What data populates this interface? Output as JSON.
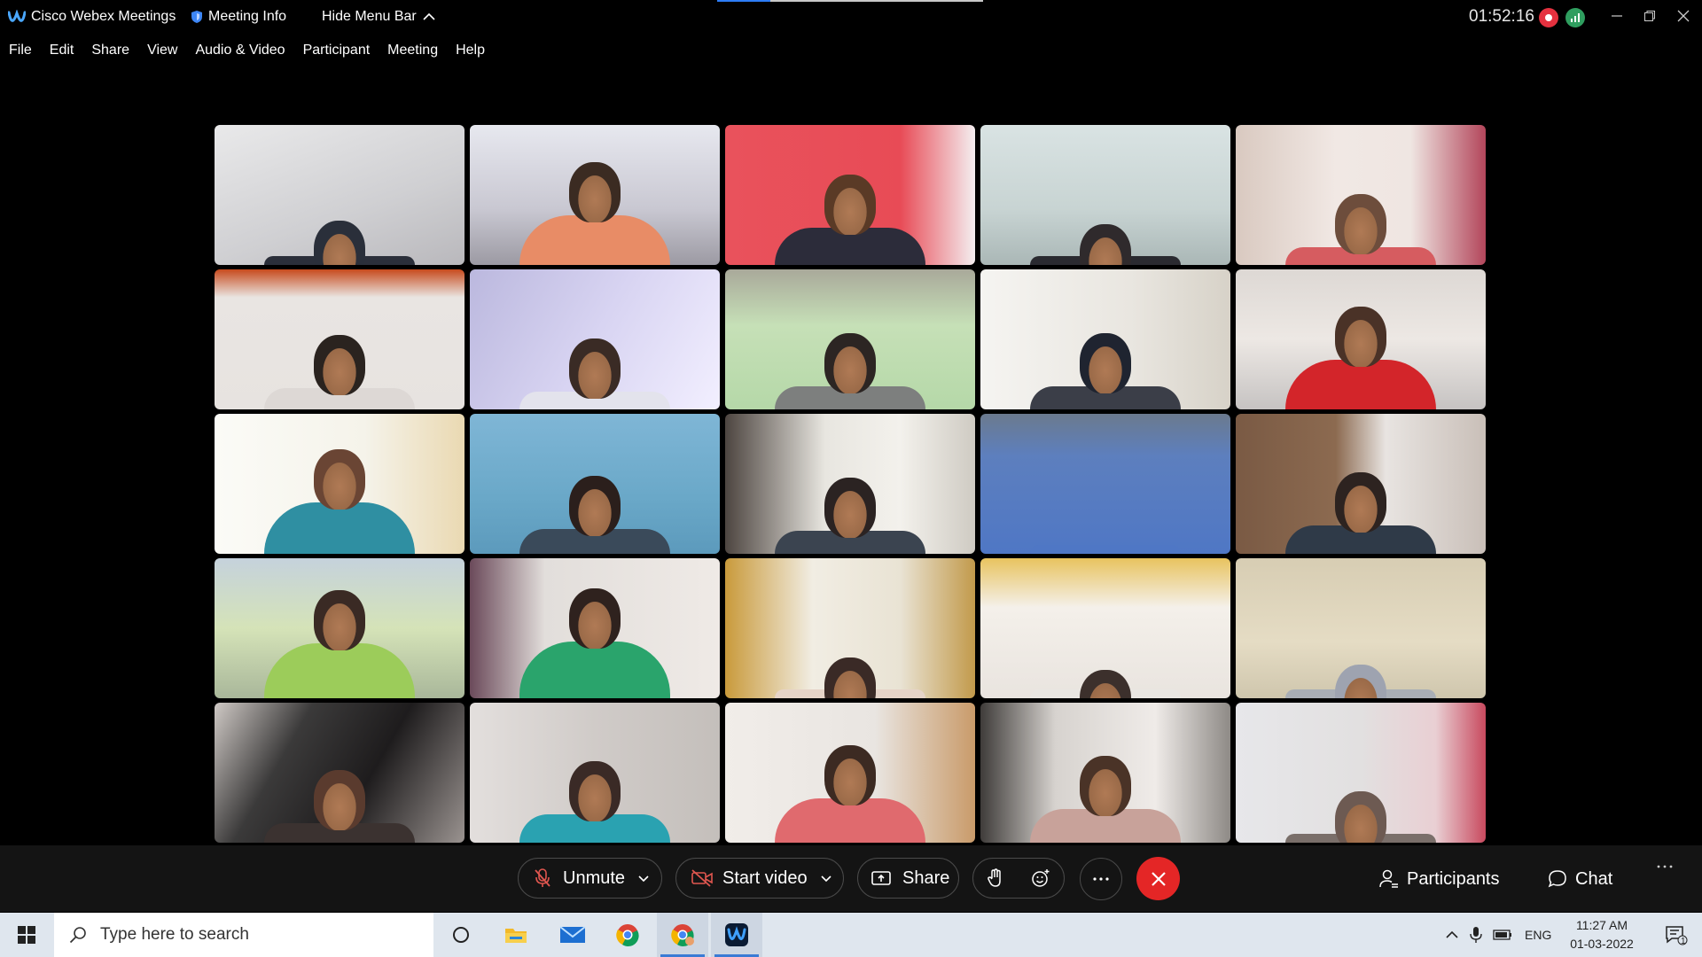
{
  "titlebar": {
    "app_name": "Cisco Webex Meetings",
    "meeting_info": "Meeting Info",
    "hide_menu": "Hide Menu Bar",
    "timer": "01:52:16"
  },
  "menu": [
    "File",
    "Edit",
    "Share",
    "View",
    "Audio & Video",
    "Participant",
    "Meeting",
    "Help"
  ],
  "tiles": [
    {
      "bg": "linear-gradient(160deg,#e9e9ea 0%,#cfcfd2 60%,#b9b8bc 100%)",
      "head": "#2a2f3a",
      "shirt": "#2b2f3a",
      "headTop": 108
    },
    {
      "bg": "linear-gradient(180deg,#e7e8ef 0%,#c9c8d2 60%,#9c9aa3 100%)",
      "head": "#3b2b22",
      "shirt": "#e88c66",
      "headTop": 42
    },
    {
      "bg": "linear-gradient(90deg,#e9525c 0%,#e84b56 70%,#f4eef0 100%)",
      "head": "#5a3a26",
      "shirt": "#2c2c3a",
      "headTop": 56
    },
    {
      "bg": "linear-gradient(180deg,#d9e3e3 0%,#c8d4d3 60%,#aab7b6 100%)",
      "head": "#2f2a2c",
      "shirt": "#2a2a30",
      "headTop": 112
    },
    {
      "bg": "linear-gradient(90deg,#d9c9c0 0%,#f1e8e4 40%,#efe6e2 70%,#b3465b 100%)",
      "head": "#6d4d3c",
      "shirt": "#d65c60",
      "headTop": 78
    },
    {
      "bg": "linear-gradient(180deg,#c74a1d 0%,#e9e5e2 20%,#e7e3e0 100%)",
      "head": "#2a231f",
      "shirt": "#ddd8d5",
      "headTop": 74
    },
    {
      "bg": "linear-gradient(120deg,#bbb8de 0%,#d8d4f2 50%,#f2efff 100%)",
      "head": "#3a2b25",
      "shirt": "#e3e3ec",
      "headTop": 78
    },
    {
      "bg": "linear-gradient(180deg,#a9a99a 0%,#c6e0b7 40%,#b5d8a8 100%)",
      "head": "#2c2523",
      "shirt": "#7d7f7e",
      "headTop": 72
    },
    {
      "bg": "linear-gradient(90deg,#f5f4f1 0%,#e9e6e0 60%,#d7d2c8 100%)",
      "head": "#1f2430",
      "shirt": "#3b3e48",
      "headTop": 72
    },
    {
      "bg": "linear-gradient(180deg,#ddd8d4 0%,#ede8e4 50%,#c6c3c2 100%)",
      "head": "#4a3227",
      "shirt": "#d3252a",
      "headTop": 42
    },
    {
      "bg": "linear-gradient(90deg,#fbfbf7 0%,#f5f3ea 60%,#ead9b2 100%)",
      "head": "#6a4534",
      "shirt": "#2f8fa2",
      "headTop": 40
    },
    {
      "bg": "linear-gradient(180deg,#7fb6d6 0%,#6aa8c8 60%,#5c9abc 100%)",
      "head": "#2b1f1c",
      "shirt": "#3a4a5a",
      "headTop": 70
    },
    {
      "bg": "linear-gradient(90deg,#4d4540 0%,#e8e6e0 40%,#f3f1ec 70%,#cfcbc3 100%)",
      "head": "#2b2322",
      "shirt": "#3b4450",
      "headTop": 72
    },
    {
      "bg": "linear-gradient(180deg,#6b7a8e 0%,#5d7fbe 30%,#4f77c5 100%)",
      "head": "#4f77c5",
      "shirt": "#4f77c5",
      "headTop": 170
    },
    {
      "bg": "linear-gradient(90deg,#7a5a44 0%,#8c6a50 40%,#e8e4e1 60%,#c9bfb8 100%)",
      "head": "#2d2320",
      "shirt": "#2f3a48",
      "headTop": 66
    },
    {
      "bg": "linear-gradient(180deg,#c5d2dc 0%,#d5e3b8 50%,#a9b79a 100%)",
      "head": "#3a2a24",
      "shirt": "#9ccc5a",
      "headTop": 36
    },
    {
      "bg": "linear-gradient(90deg,#6b4a5a 0%,#e2dedb 30%,#efeae6 100%)",
      "head": "#2f221e",
      "shirt": "#2aa46c",
      "headTop": 34
    },
    {
      "bg": "linear-gradient(90deg,#c99a3b 0%,#f1ede3 35%,#e9e3d4 70%,#c29a4b 100%)",
      "head": "#3a2a26",
      "shirt": "#e6d4c8",
      "headTop": 112
    },
    {
      "bg": "linear-gradient(180deg,#e8c35f 0%,#f4f0ea 35%,#e9e4df 100%)",
      "head": "#3c302c",
      "shirt": "#e9e6e2",
      "headTop": 126
    },
    {
      "bg": "linear-gradient(180deg,#d7cdb3 0%,#e5dcc4 60%,#cfc6ad 100%)",
      "head": "#9ea3b0",
      "shirt": "#a9aeb6",
      "headTop": 120
    },
    {
      "bg": "linear-gradient(120deg,#cfc9c5 0%,#3b3a3a 30%,#1e1c1d 60%,#9a9390 100%)",
      "head": "#5a3b2e",
      "shirt": "#3b3230",
      "headTop": 76
    },
    {
      "bg": "linear-gradient(90deg,#e3dfdd 0%,#d0cbc8 50%,#c4bfbb 100%)",
      "head": "#3a2a26",
      "shirt": "#2aa2b1",
      "headTop": 66
    },
    {
      "bg": "linear-gradient(90deg,#f1ede9 0%,#e9e5e1 60%,#c99b6a 100%)",
      "head": "#3c2a22",
      "shirt": "#e06a6e",
      "headTop": 48
    },
    {
      "bg": "linear-gradient(90deg,#3f3c3a 0%,#d7d3cf 30%,#efebe8 70%,#8e8a86 100%)",
      "head": "#4a3327",
      "shirt": "#c8a29a",
      "headTop": 60
    },
    {
      "bg": "linear-gradient(90deg,#e7e7ea 0%,#e2e0e0 50%,#e9cfd3 80%,#c84a5f 100%)",
      "head": "#6d5a52",
      "shirt": "#7a6f6a",
      "headTop": 100
    }
  ],
  "controls": {
    "unmute": "Unmute",
    "start_video": "Start video",
    "share": "Share",
    "participants": "Participants",
    "chat": "Chat"
  },
  "taskbar": {
    "search_placeholder": "Type here to search",
    "lang": "ENG",
    "time": "11:27 AM",
    "date": "01-03-2022",
    "notifications": "1"
  },
  "colors": {
    "end_button": "#e42626",
    "record": "#e5313f",
    "network": "#2f9e5f",
    "accent": "#2d7df6"
  }
}
